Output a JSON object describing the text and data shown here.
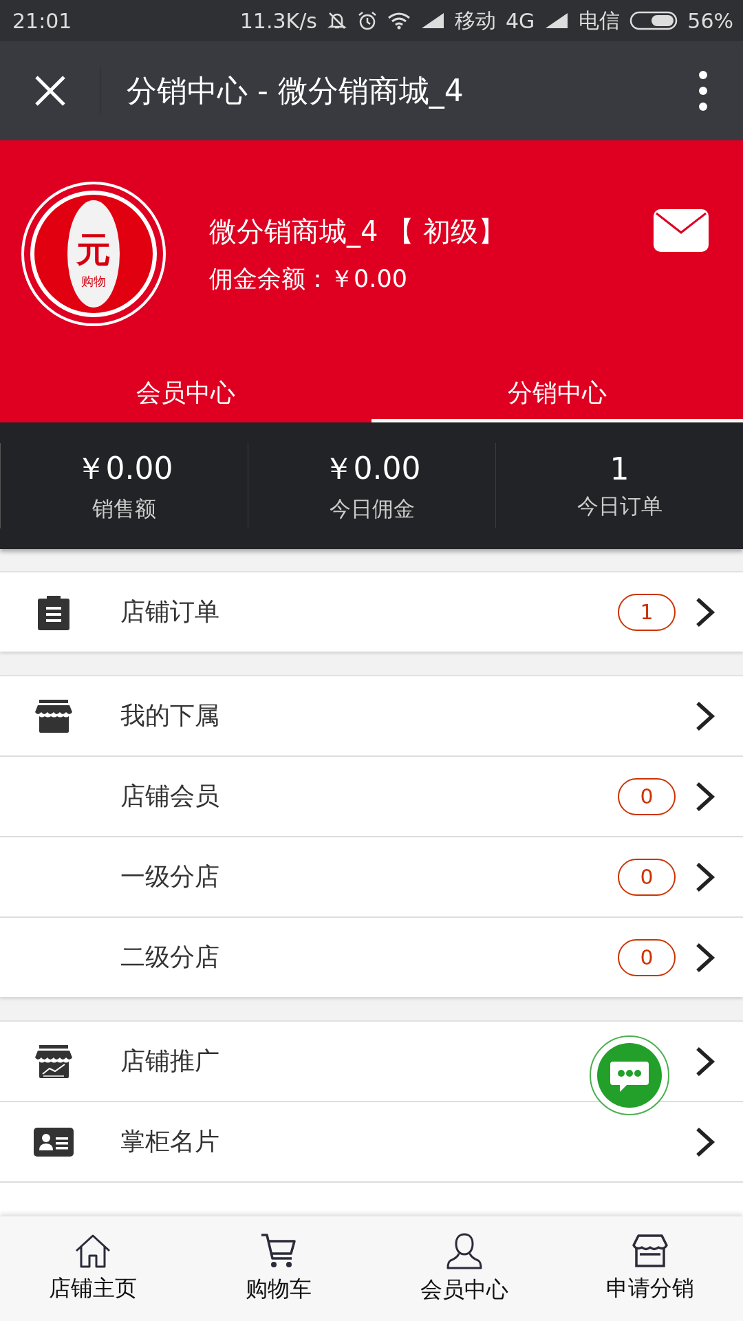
{
  "status_bar": {
    "time": "21:01",
    "speed": "11.3K/s",
    "carrier_1": "移动",
    "network": "4G",
    "carrier_2": "电信",
    "battery": "56%"
  },
  "nav_bar": {
    "title": "分销中心 - 微分销商城_4"
  },
  "profile": {
    "logo": {
      "main": "元",
      "sub": "购物"
    },
    "name": "微分销商城_4 【 初级】",
    "balance": "佣金余额：￥0.00"
  },
  "tabs": [
    {
      "label": "会员中心",
      "selected": false
    },
    {
      "label": "分销中心",
      "selected": true
    }
  ],
  "stats": [
    {
      "value": "￥0.00",
      "label": "销售额"
    },
    {
      "value": "￥0.00",
      "label": "今日佣金"
    },
    {
      "value": "1",
      "label": "今日订单"
    }
  ],
  "sections": [
    [
      {
        "kind": "icon",
        "label": "店铺订单",
        "badge": "1"
      }
    ],
    [
      {
        "kind": "icon",
        "label": "我的下属"
      },
      {
        "kind": "plain",
        "label": "店铺会员",
        "badge": "0"
      },
      {
        "kind": "plain",
        "label": "一级分店",
        "badge": "0"
      },
      {
        "kind": "plain",
        "label": "二级分店",
        "badge": "0"
      }
    ],
    [
      {
        "kind": "icon",
        "label": "店铺推广"
      },
      {
        "kind": "icon",
        "label": "掌柜名片"
      },
      {
        "kind": "cut"
      }
    ]
  ],
  "bottom_nav": [
    {
      "label": "店铺主页"
    },
    {
      "label": "购物车"
    },
    {
      "label": "会员中心"
    },
    {
      "label": "申请分销"
    }
  ]
}
